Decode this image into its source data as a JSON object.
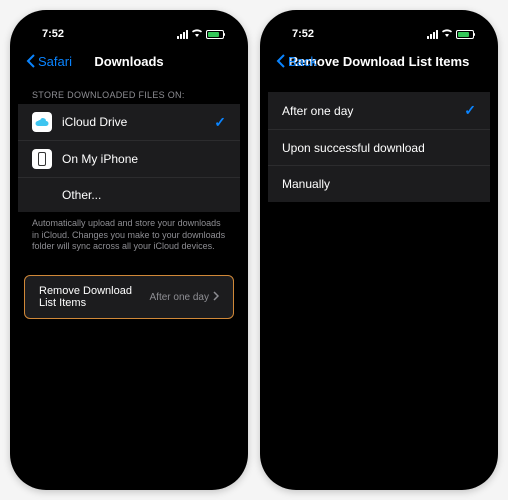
{
  "statusBar": {
    "time": "7:52"
  },
  "phone1": {
    "nav": {
      "back": "Safari",
      "title": "Downloads"
    },
    "sectionHeader": "STORE DOWNLOADED FILES ON:",
    "storage": {
      "icloud": "iCloud Drive",
      "onPhone": "On My iPhone",
      "other": "Other..."
    },
    "footer": "Automatically upload and store your downloads in iCloud. Changes you make to your downloads folder will sync across all your iCloud devices.",
    "removeRow": {
      "label": "Remove Download List Items",
      "value": "After one day"
    }
  },
  "phone2": {
    "nav": {
      "back": "Back",
      "title": "Remove Download List Items"
    },
    "options": {
      "afterOneDay": "After one day",
      "uponSuccess": "Upon successful download",
      "manually": "Manually"
    }
  }
}
